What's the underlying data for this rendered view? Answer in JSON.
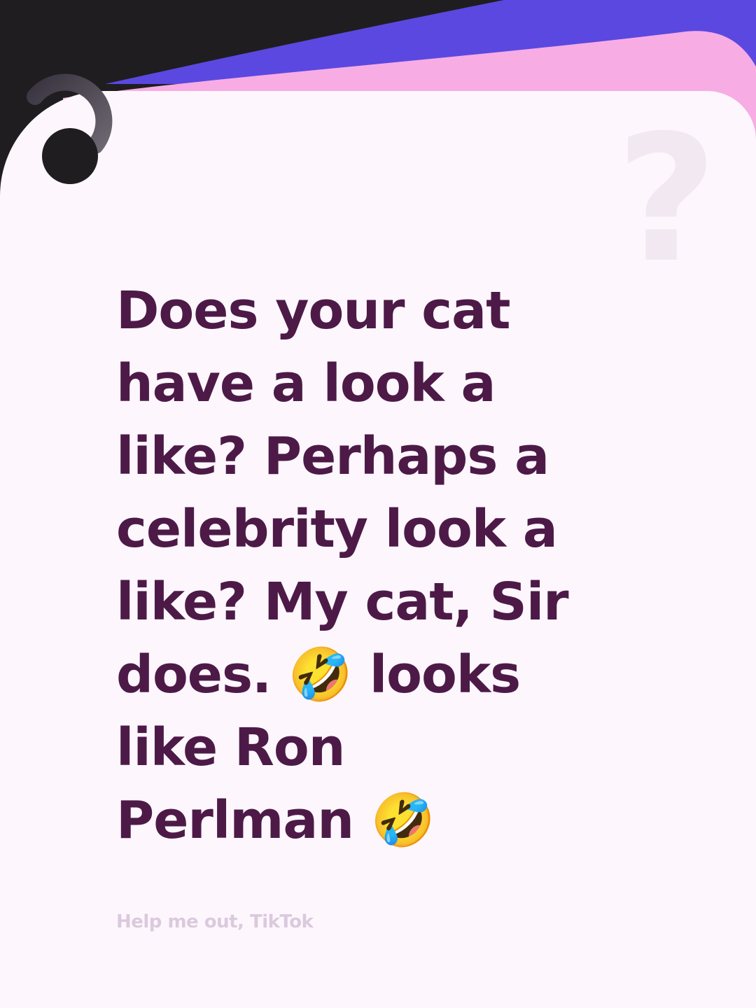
{
  "post": {
    "question": "Does your cat\nhave a look a\nlike? Perhaps a\ncelebrity look a\nlike? My cat, Sir\ndoes. 🤣 looks\nlike Ron\nPerlman 🤣",
    "footer": "Help me out, TikTok"
  },
  "icons": {
    "top_left": "question-mark-icon",
    "top_right": "faint-question-mark-icon"
  },
  "colors": {
    "background_dark": "#1f1d20",
    "accent_purple": "#5b48e0",
    "accent_pink": "#f8ace4",
    "card": "#fdf7fd",
    "text": "#4d1a48",
    "footer_text": "#dbc9de"
  }
}
